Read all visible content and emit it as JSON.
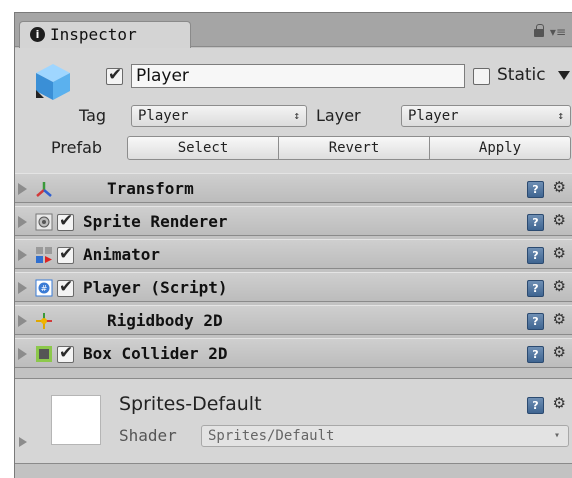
{
  "window": {
    "tab_label": "Inspector",
    "info_glyph": "i",
    "lock_icon": "lock-icon",
    "menu_glyph": "▾≡"
  },
  "gameobject": {
    "active": true,
    "name": "Player",
    "static_label": "Static",
    "static_checked": false,
    "tag_label": "Tag",
    "tag_value": "Player",
    "layer_label": "Layer",
    "layer_value": "Player",
    "prefab_label": "Prefab",
    "prefab_buttons": {
      "select": "Select",
      "revert": "Revert",
      "apply": "Apply"
    },
    "popup_arrow": "↕"
  },
  "components": [
    {
      "name": "Transform",
      "icon": "transform-icon",
      "has_checkbox": false,
      "checked": false
    },
    {
      "name": "Sprite Renderer",
      "icon": "sprite-renderer-icon",
      "has_checkbox": true,
      "checked": true
    },
    {
      "name": "Animator",
      "icon": "animator-icon",
      "has_checkbox": true,
      "checked": true
    },
    {
      "name": "Player (Script)",
      "icon": "script-icon",
      "has_checkbox": true,
      "checked": true
    },
    {
      "name": "Rigidbody 2D",
      "icon": "rigidbody2d-icon",
      "has_checkbox": false,
      "checked": false
    },
    {
      "name": "Box Collider 2D",
      "icon": "box-collider-icon",
      "has_checkbox": true,
      "checked": true
    }
  ],
  "help_glyph": "?",
  "gear_glyph": "⚙",
  "material": {
    "name": "Sprites-Default",
    "shader_label": "Shader",
    "shader_value": "Sprites/Default",
    "shader_arrow": "▾"
  }
}
